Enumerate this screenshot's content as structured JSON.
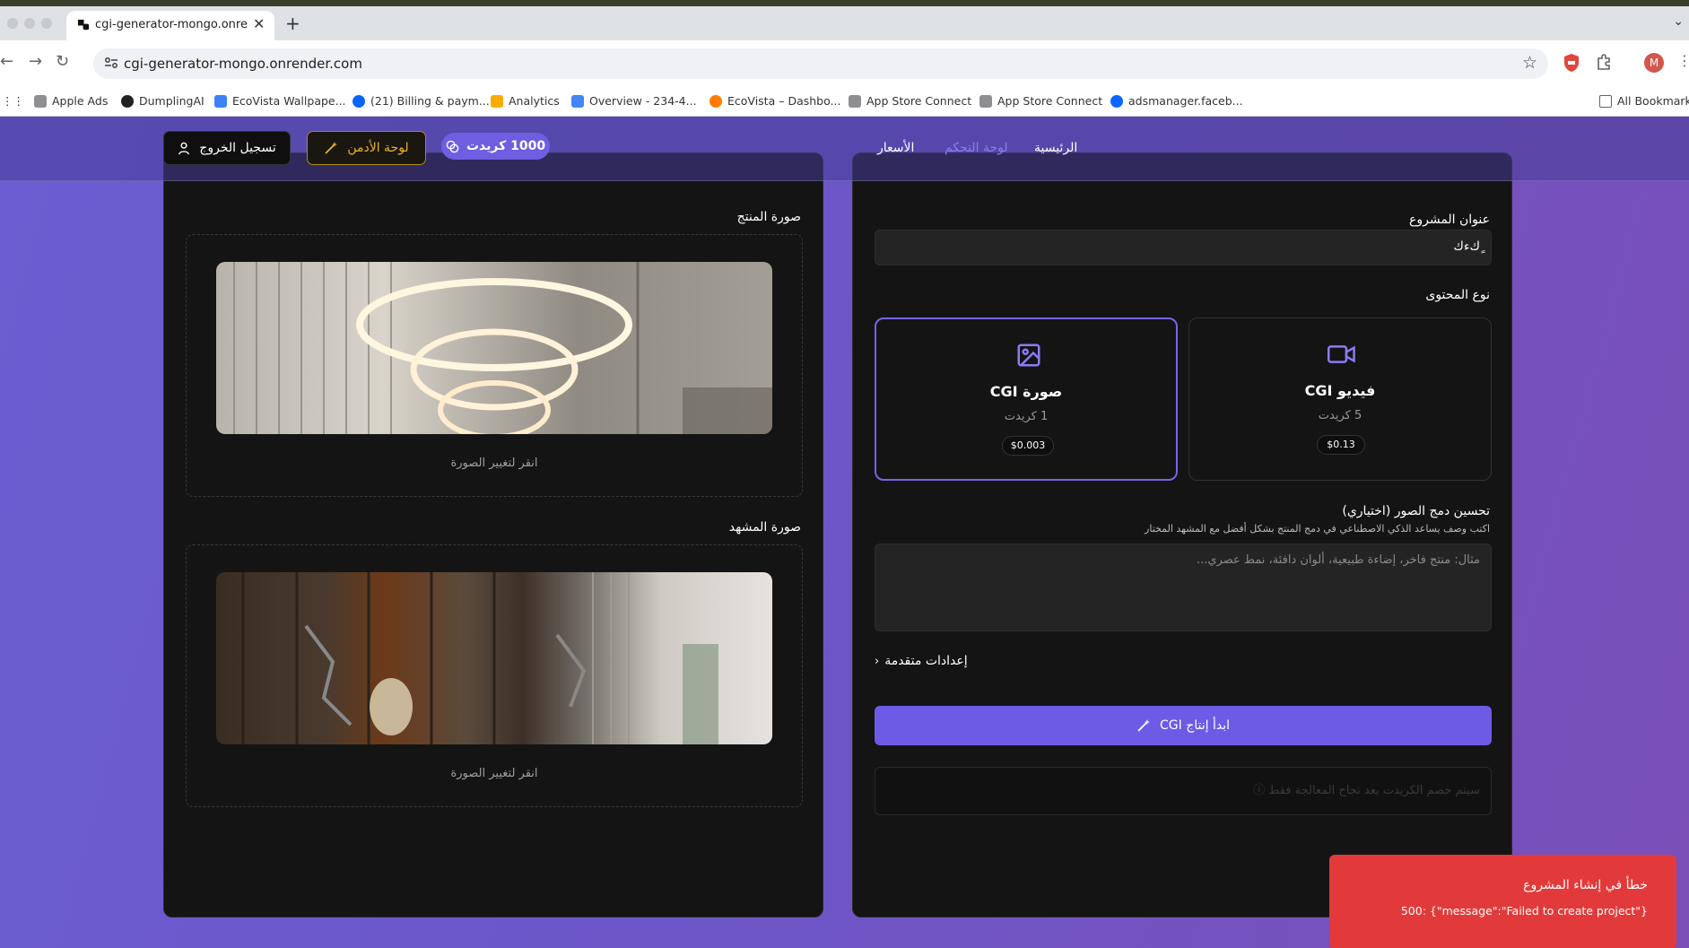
{
  "browser": {
    "tab_title": "cgi-generator-mongo.onrender.com",
    "url": "cgi-generator-mongo.onrender.com",
    "bookmarks": [
      {
        "label": "Apple Ads",
        "icon": "apple-icon"
      },
      {
        "label": "DumplingAI",
        "icon": "dumpling-icon"
      },
      {
        "label": "EcoVista Wallpape...",
        "icon": "ecovista-icon"
      },
      {
        "label": "(21) Billing & paym...",
        "icon": "meta-icon"
      },
      {
        "label": "Analytics",
        "icon": "analytics-icon"
      },
      {
        "label": "Overview - 234-4...",
        "icon": "google-ads-icon"
      },
      {
        "label": "EcoVista – Dashbo...",
        "icon": "firebase-icon"
      },
      {
        "label": "App Store Connect",
        "icon": "apple-icon"
      },
      {
        "label": "App Store Connect",
        "icon": "apple-icon"
      },
      {
        "label": "adsmanager.faceb...",
        "icon": "meta-icon"
      }
    ],
    "all_bookmarks": "All Bookmarks",
    "profile_initial": "M"
  },
  "navbar": {
    "links": [
      "الرئيسية",
      "لوحة التحكم",
      "الأسعار"
    ],
    "credits": "1000 كريدت",
    "admin": "لوحة الأدمن",
    "logout": "تسجيل الخروج"
  },
  "form": {
    "project_title_label": "عنوان المشروع",
    "project_title_value": "ٍكءك",
    "content_type_label": "نوع المحتوى",
    "options": [
      {
        "title": "صورة CGI",
        "credits": "1 كريدت",
        "price": "$0.003"
      },
      {
        "title": "فيديو CGI",
        "credits": "5 كريدت",
        "price": "$0.13"
      }
    ],
    "enhance_label": "تحسين دمج الصور (اختياري)",
    "enhance_help": "اكتب وصف يساعد الذكي الاصطناعي في دمج المنتج بشكل أفضل مع المشهد المختار",
    "enhance_placeholder": "مثال: منتج فاخر، إضاءة طبيعية، ألوان دافئة، نمط عصري...",
    "advanced": "إعدادات متقدمة",
    "generate": "ابدأ إنتاج CGI",
    "status_note": "سيتم خصم الكريدت بعد نجاح المعالجة فقط"
  },
  "uploads": {
    "product_label": "صورة المنتج",
    "scene_label": "صورة المشهد",
    "change_hint": "انقر لتغيير الصورة"
  },
  "toast": {
    "title": "خطأ في إنشاء المشروع",
    "message": "500: {\"message\":\"Failed to create project\"}"
  },
  "colors": {
    "accent": "#6d5be6",
    "gold": "#e8b62b",
    "error": "#e23a3a"
  }
}
